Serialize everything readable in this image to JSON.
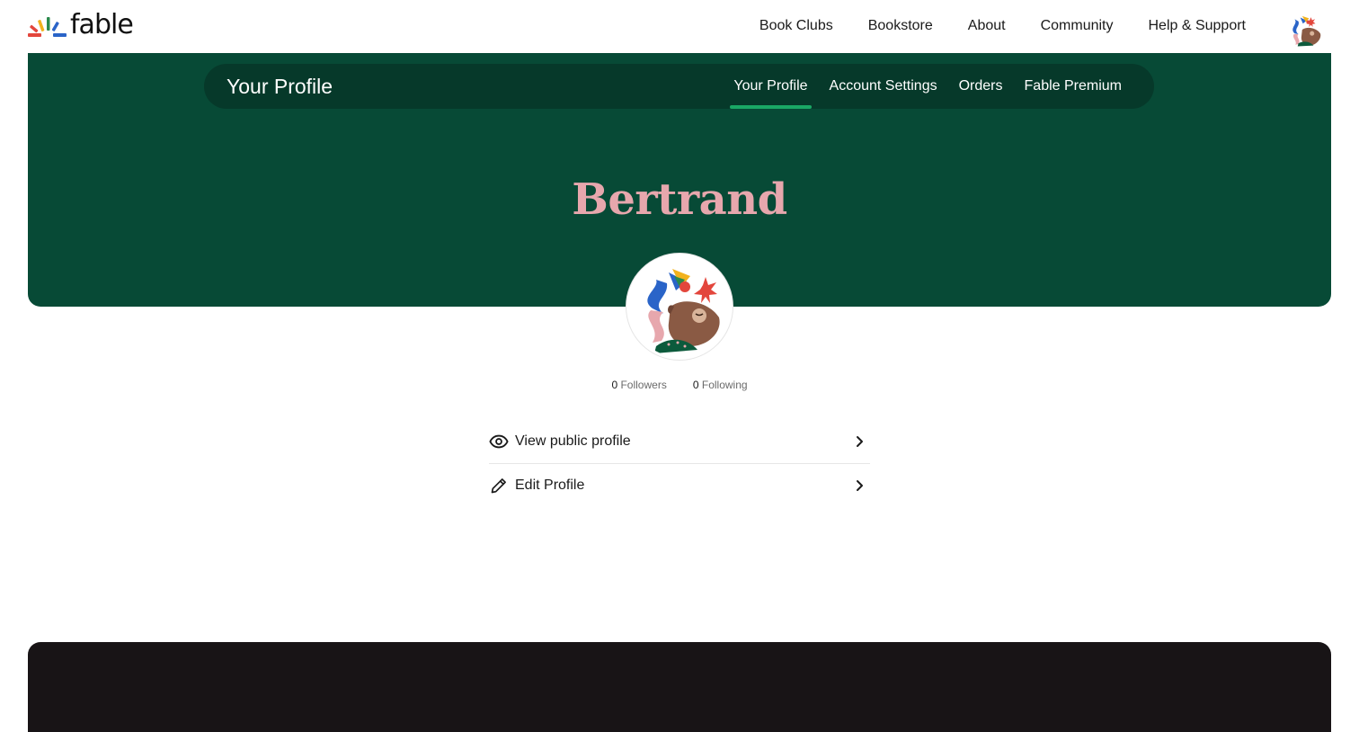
{
  "brand": {
    "logo_text": "fable",
    "logo_colors": [
      "#e3463c",
      "#f2b21d",
      "#2b8a4c",
      "#2a64c8"
    ]
  },
  "main_nav": {
    "items": [
      "Book Clubs",
      "Bookstore",
      "About",
      "Community",
      "Help & Support"
    ]
  },
  "subnav": {
    "title": "Your Profile",
    "tabs": [
      {
        "label": "Your Profile",
        "active": true
      },
      {
        "label": "Account Settings",
        "active": false
      },
      {
        "label": "Orders",
        "active": false
      },
      {
        "label": "Fable Premium",
        "active": false
      }
    ]
  },
  "profile": {
    "name": "Bertrand",
    "avatar_icon": "bear-with-bird-illustration",
    "followers_count": "0",
    "followers_label": "Followers",
    "following_count": "0",
    "following_label": "Following"
  },
  "actions": [
    {
      "label": "View public profile",
      "icon": "eye-icon"
    },
    {
      "label": "Edit Profile",
      "icon": "pencil-icon"
    }
  ],
  "colors": {
    "hero_bg": "#074a36",
    "subnav_bg": "#06392a",
    "active_tab_underline": "#1aa765",
    "name_pink": "#e7a7ad",
    "footer_bg": "#181416"
  }
}
